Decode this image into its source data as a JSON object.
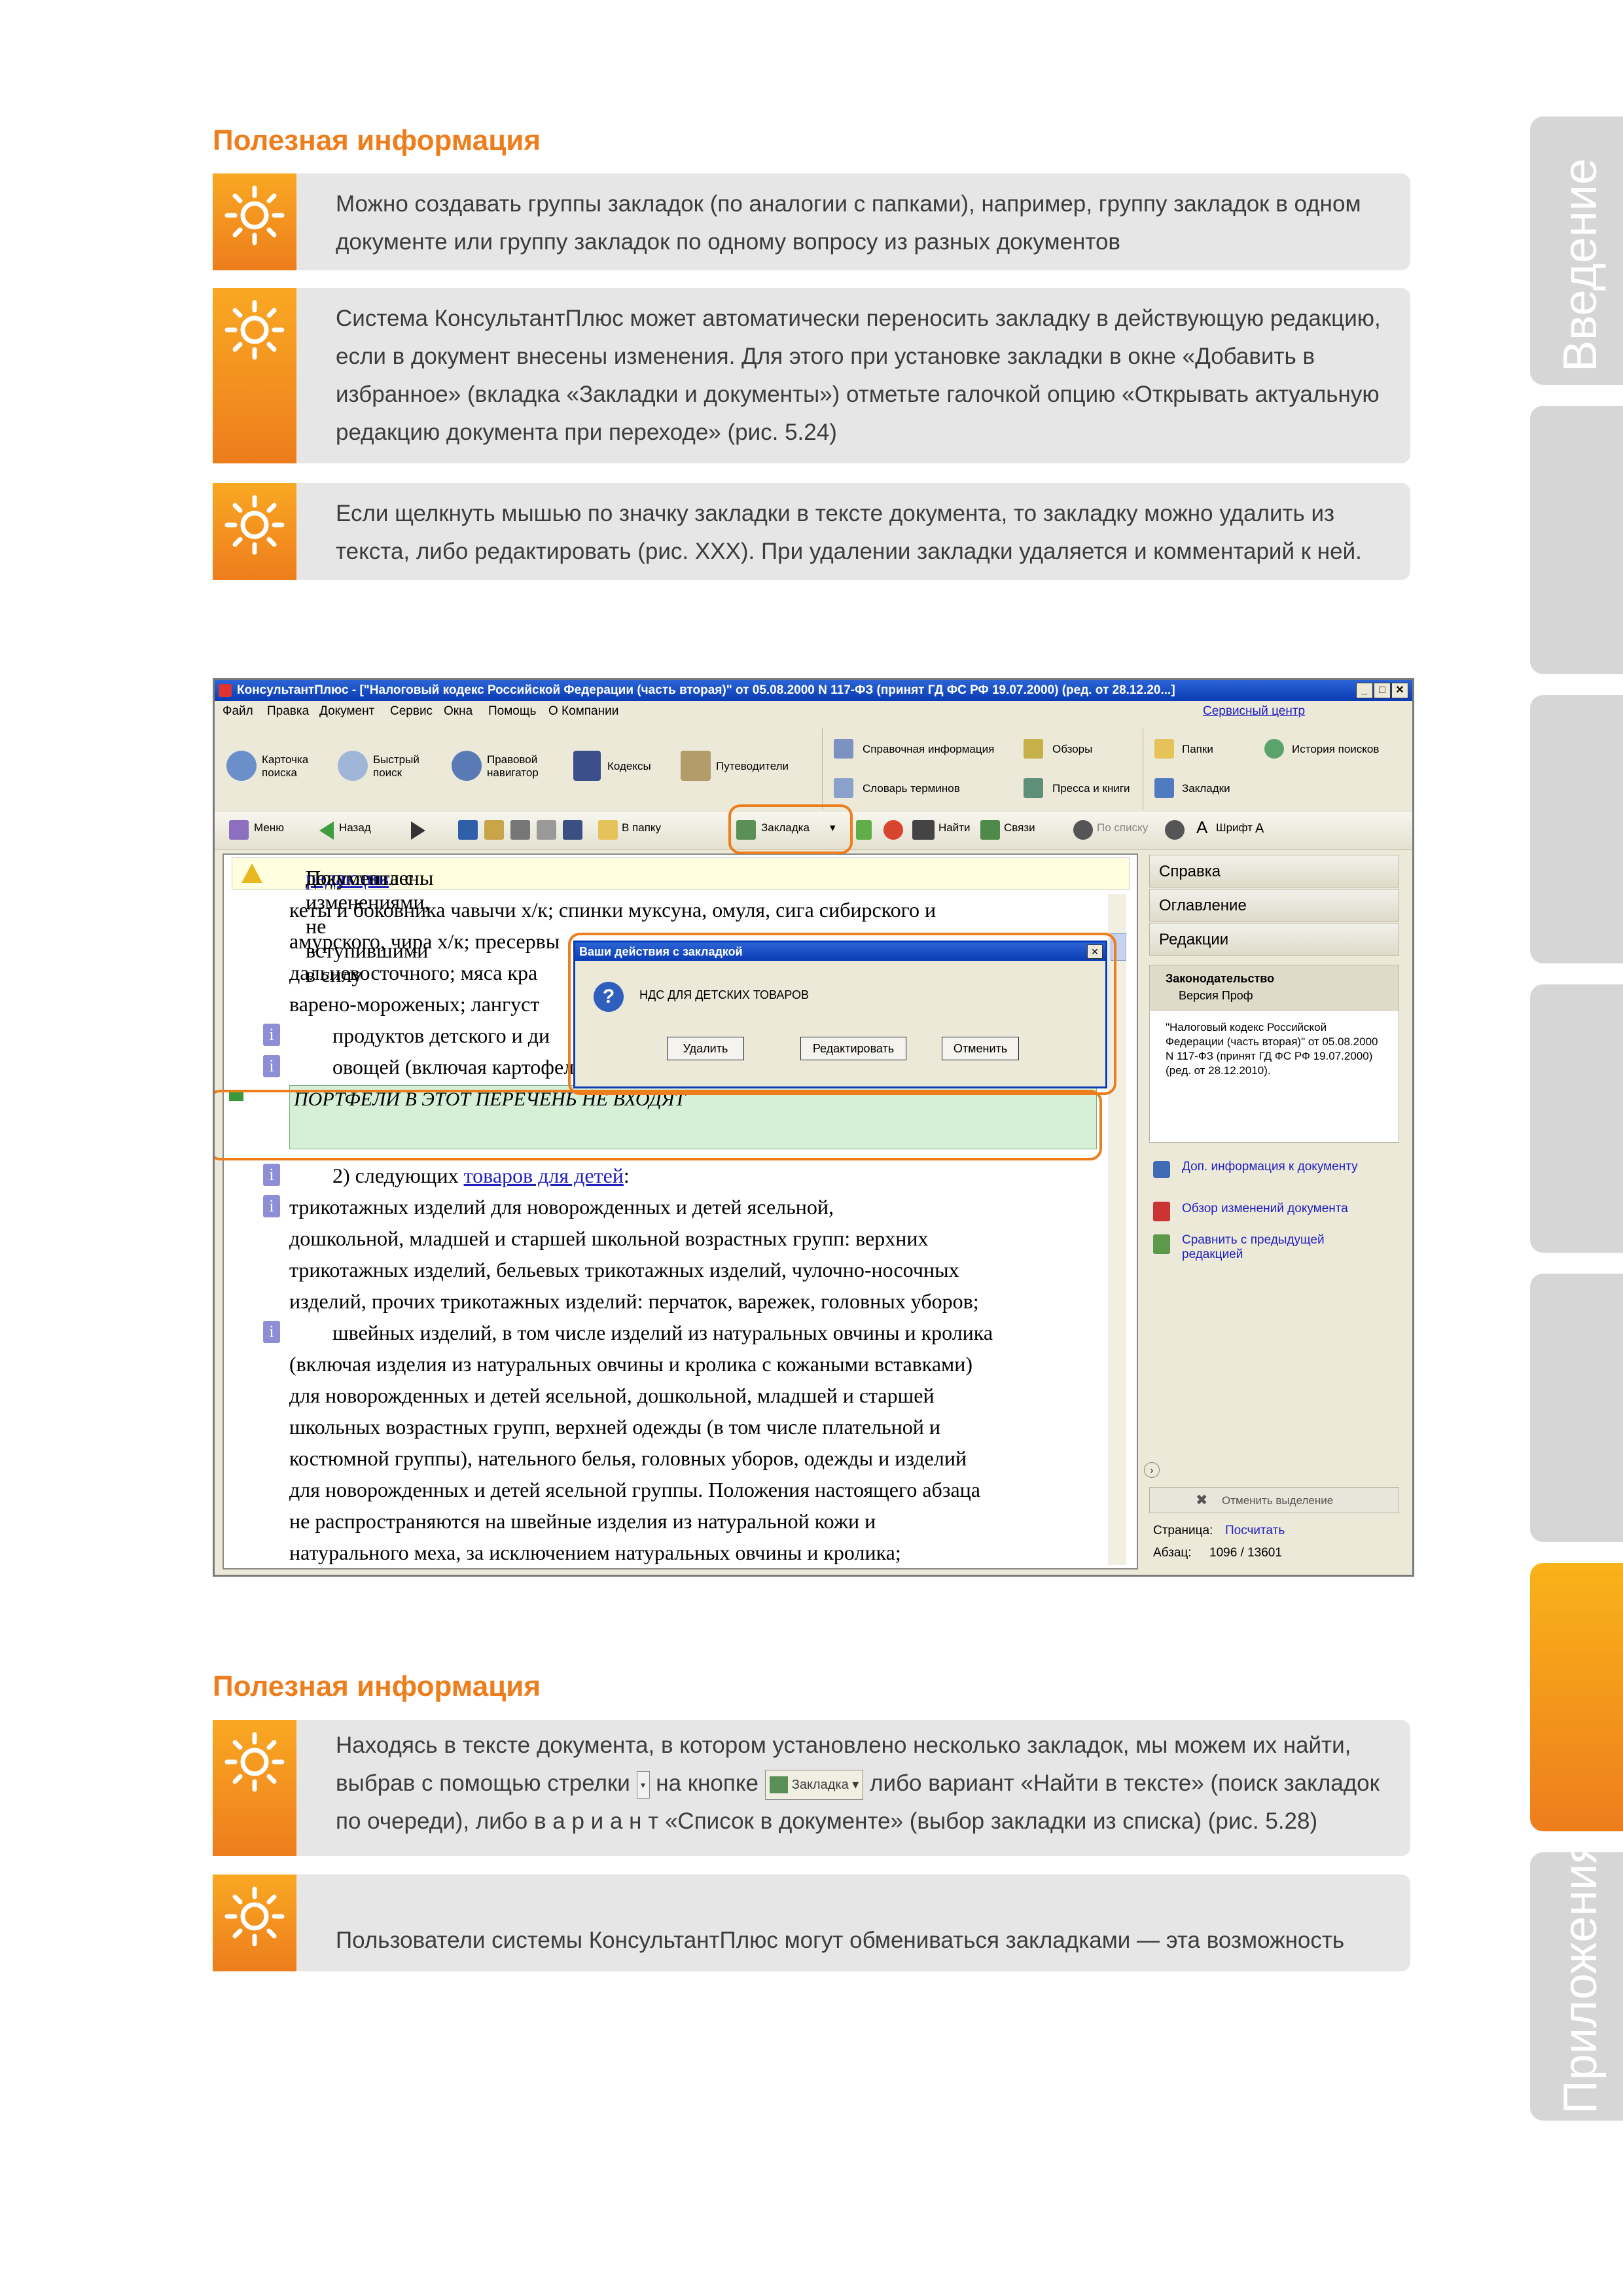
{
  "section_header_top": "Полезная информация",
  "info_boxes_top": [
    "Можно создавать группы закладок (по аналогии с папками), например, группу закладок в одном документе или группу закладок по одному вопросу из разных документов",
    "Система КонсультантПлюс может автоматически переносить закладку в действующую редакцию, если в документ внесены изменения. Для этого при установке закладки в окне «Добавить в избранное» (вкладка «Закладки и документы») отметьте галочкой опцию «Открывать актуальную редакцию документа при переходе» (рис. 5.24)",
    "Если щелкнуть мышью по значку закладки в тексте документа, то закладку можно удалить из текста, либо редактировать (рис. XXX). При удалении закладки удаляется и комментарий к ней."
  ],
  "side_tabs": [
    "Введение",
    "",
    "",
    "",
    "",
    "",
    "Приложения"
  ],
  "screenshot": {
    "title": "КонсультантПлюс - [\"Налоговый кодекс Российской Федерации (часть вторая)\" от 05.08.2000 N 117-ФЗ (принят ГД ФС РФ 19.07.2000) (ред. от 28.12.20...]",
    "menu": [
      "Файл",
      "Правка",
      "Документ",
      "Сервис",
      "Окна",
      "Помощь",
      "О Компании"
    ],
    "service_link": "Сервисный центр",
    "ribbon": {
      "card_search": "Карточка поиска",
      "quick_search": "Быстрый поиск",
      "legal_nav": "Правовой навигатор",
      "codes": "Кодексы",
      "guides": "Путеводители",
      "ref_info": "Справочная информация",
      "dictionary": "Словарь терминов",
      "reviews": "Обзоры",
      "press": "Пресса и книги",
      "folders": "Папки",
      "history": "История поисков",
      "bookmarks": "Закладки"
    },
    "toolbar": {
      "menu": "Меню",
      "back": "Назад",
      "to_folder": "В папку",
      "bookmark": "Закладка",
      "find": "Найти",
      "links": "Связи",
      "by_list": "По списку",
      "font": "Шрифт"
    },
    "notice": {
      "before": "Подготовлены ",
      "link": "редакции",
      "after": " документа с изменениями, не вступившими в силу"
    },
    "doc_lines": {
      "p1_l1": "кеты и боковника чавычи х/к; спинки муксуна, омуля, сига сибирского и",
      "p1_l2": "амурского, чира х/к; пресервы",
      "p1_l3": "дальневосточного; мяса кра",
      "p1_l4": "варено-мороженых; лангуст",
      "p2": "продуктов детского и ди",
      "p3": "овощей (включая картофель);",
      "bookmark_text": "ПОРТФЕЛИ В ЭТОТ ПЕРЕЧЕНЬ НЕ ВХОДЯТ",
      "p4_before": "2) следующих ",
      "p4_link": "товаров для детей",
      "p4_after": ":",
      "p5_l1": "трикотажных изделий для новорожденных и детей ясельной,",
      "p5_l2": "дошкольной, младшей и старшей школьной возрастных групп: верхних",
      "p5_l3": "трикотажных изделий, бельевых трикотажных изделий, чулочно-носочных",
      "p5_l4": "изделий, прочих трикотажных изделий: перчаток, варежек, головных уборов;",
      "p6_l1": "швейных изделий, в том числе изделий из натуральных овчины и кролика",
      "p6_l2": "(включая изделия из натуральных овчины и кролика с кожаными вставками)",
      "p6_l3": "для новорожденных и детей ясельной, дошкольной, младшей и старшей",
      "p6_l4": "школьных возрастных групп, верхней одежды (в том числе плательной и",
      "p6_l5": "костюмной группы), нательного белья, головных уборов, одежды и изделий",
      "p6_l6": "для новорожденных и детей ясельной группы. Положения настоящего абзаца",
      "p6_l7": "не распространяются на швейные изделия из натуральной кожи и",
      "p6_l8": "натурального меха, за исключением натуральных овчины и кролика;"
    },
    "dialog": {
      "title": "Ваши действия с закладкой",
      "message": "НДС ДЛЯ ДЕТСКИХ ТОВАРОВ",
      "delete": "Удалить",
      "edit": "Редактировать",
      "cancel": "Отменить"
    },
    "sidebar": {
      "help": "Справка",
      "contents": "Оглавление",
      "editions": "Редакции",
      "legislation": "Законодательство",
      "version": "Версия Проф",
      "doc_desc": "\"Налоговый кодекс Российской Федерации (часть вторая)\" от 05.08.2000 N 117-ФЗ (принят ГД ФС РФ 19.07.2000) (ред. от 28.12.2010).",
      "more_info": "Доп. информация к документу",
      "changes": "Обзор изменений документа",
      "compare": "Сравнить с предыдущей редакцией",
      "cancel_sel": "Отменить выделение",
      "page_label": "Страница:",
      "page_link": "Посчитать",
      "para_label": "Абзац:",
      "para_value": "1096 / 13601"
    }
  },
  "section_header_bottom": "Полезная информация",
  "info_boxes_bottom": {
    "b1_p1": "Находясь в тексте документа, в котором установлено несколько закладок, мы можем их найти, выбрав с помощью стрелки ",
    "b1_p2": " на кнопке ",
    "b1_button": "Закладка",
    "b1_p3": " либо вариант «Найти в тексте» (поиск закладок по очереди), либо  в а р и а н т                «Список в документе» (выбор закладки из списка) (рис. 5.28)",
    "b2": "Пользователи системы КонсультантПлюс могут обмениваться закладками — эта возможность"
  },
  "colors": {
    "accent": "#ee7d1c",
    "accent_light": "#f9a823",
    "box_bg": "#e6e6e6",
    "tab_bg": "#d6d6d6"
  }
}
